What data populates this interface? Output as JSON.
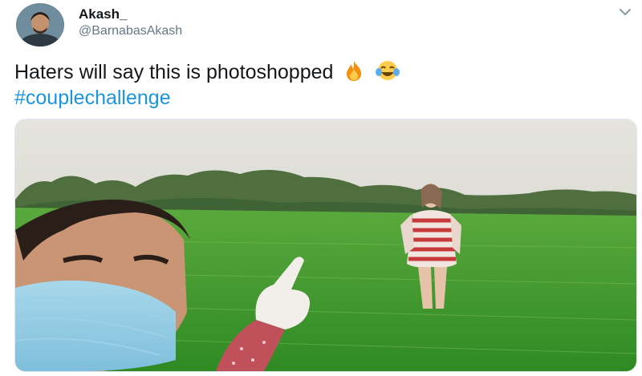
{
  "tweet": {
    "display_name": "Akash_",
    "handle": "@BarnabasAkash",
    "text": "Haters will say this is photoshopped",
    "emojis": [
      "fire-emoji",
      "tears-of-joy-emoji"
    ],
    "hashtag": "#couplechallenge",
    "menu_icon": "chevron-down-icon"
  },
  "colors": {
    "text": "#14171a",
    "muted": "#657786",
    "link": "#1b95e0",
    "field_green": "#3f9a2f",
    "sky": "#dcdcd6"
  }
}
